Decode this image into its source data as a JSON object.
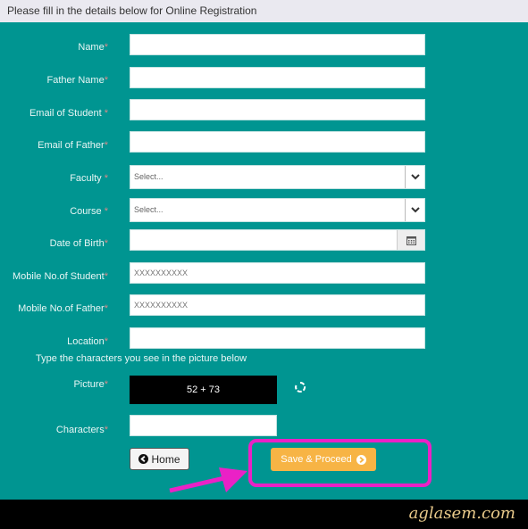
{
  "header": {
    "title": "Please fill in the details below for Online Registration"
  },
  "form": {
    "required_marker": "*",
    "fields": [
      {
        "label": "Name",
        "value": "",
        "placeholder": ""
      },
      {
        "label": "Father Name",
        "value": "",
        "placeholder": ""
      },
      {
        "label": "Email of Student ",
        "value": "",
        "placeholder": ""
      },
      {
        "label": "Email of Father",
        "value": "",
        "placeholder": ""
      },
      {
        "label": "Faculty ",
        "type": "select",
        "selected": "Select..."
      },
      {
        "label": "Course ",
        "type": "select",
        "selected": "Select..."
      },
      {
        "label": "Date of Birth",
        "type": "date",
        "value": ""
      },
      {
        "label": "Mobile No.of Student",
        "value": "",
        "placeholder": "XXXXXXXXXX"
      },
      {
        "label": "Mobile No.of Father",
        "value": "",
        "placeholder": "XXXXXXXXXX"
      },
      {
        "label": "Location",
        "value": "",
        "placeholder": ""
      }
    ],
    "captcha_instruction": "Type the characters you see in the picture below",
    "picture_label": "Picture",
    "captcha_text": "52 + 73",
    "characters_label": "Characters",
    "characters_value": ""
  },
  "buttons": {
    "home_label": "Home",
    "save_label": "Save & Proceed"
  },
  "icons": {
    "select_arrow": "chevron-down-icon",
    "date": "calendar-icon",
    "refresh": "refresh-icon",
    "home": "arrow-circle-left-icon",
    "save": "arrow-circle-right-icon"
  },
  "colors": {
    "background": "#009591",
    "header": "#eae9f0",
    "save_button": "#f7b445",
    "highlight": "#ea21c6"
  },
  "watermark": "aglasem.com"
}
